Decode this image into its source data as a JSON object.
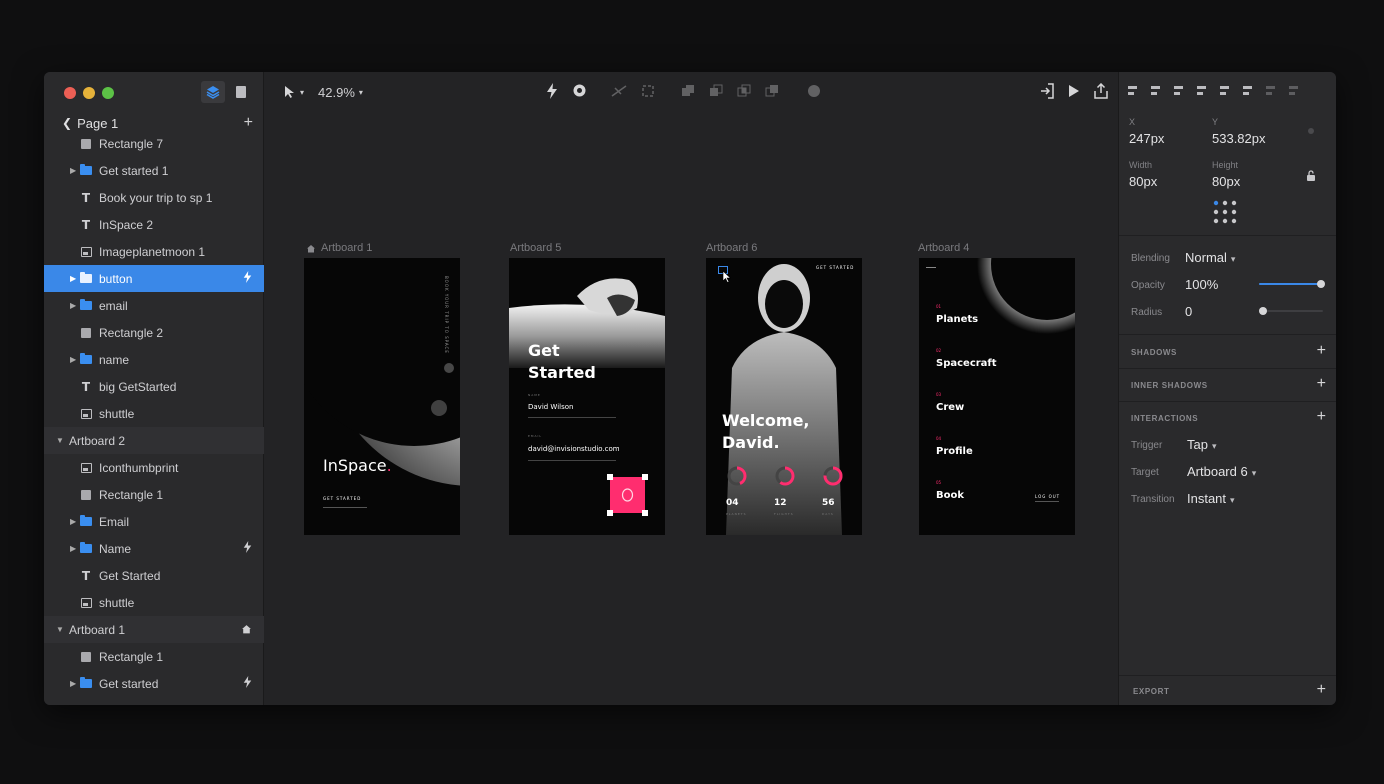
{
  "sidebar": {
    "page_name": "Page 1",
    "layers": [
      {
        "name": "Rectangle 7",
        "kind": "rect",
        "indent": 1,
        "expandable": false,
        "selected": false,
        "section": false,
        "badge": ""
      },
      {
        "name": "Get started 1",
        "kind": "folder",
        "indent": 1,
        "expandable": true,
        "selected": false,
        "section": false,
        "badge": ""
      },
      {
        "name": "Book your trip to sp 1",
        "kind": "text",
        "indent": 1,
        "expandable": false,
        "selected": false,
        "section": false,
        "badge": ""
      },
      {
        "name": "InSpace 2",
        "kind": "text",
        "indent": 1,
        "expandable": false,
        "selected": false,
        "section": false,
        "badge": ""
      },
      {
        "name": "Imageplanetmoon 1",
        "kind": "image",
        "indent": 1,
        "expandable": false,
        "selected": false,
        "section": false,
        "badge": ""
      },
      {
        "name": "button",
        "kind": "folder",
        "indent": 1,
        "expandable": true,
        "selected": true,
        "section": false,
        "badge": "bolt"
      },
      {
        "name": "email",
        "kind": "folder",
        "indent": 1,
        "expandable": true,
        "selected": false,
        "section": false,
        "badge": ""
      },
      {
        "name": "Rectangle 2",
        "kind": "rect",
        "indent": 1,
        "expandable": false,
        "selected": false,
        "section": false,
        "badge": ""
      },
      {
        "name": "name",
        "kind": "folder",
        "indent": 1,
        "expandable": true,
        "selected": false,
        "section": false,
        "badge": ""
      },
      {
        "name": "big GetStarted",
        "kind": "text",
        "indent": 1,
        "expandable": false,
        "selected": false,
        "section": false,
        "badge": ""
      },
      {
        "name": "shuttle",
        "kind": "image",
        "indent": 1,
        "expandable": false,
        "selected": false,
        "section": false,
        "badge": ""
      },
      {
        "name": "Artboard 2",
        "kind": "artboard",
        "indent": 0,
        "expandable": true,
        "selected": false,
        "section": true,
        "badge": ""
      },
      {
        "name": "Iconthumbprint",
        "kind": "image",
        "indent": 1,
        "expandable": false,
        "selected": false,
        "section": false,
        "badge": ""
      },
      {
        "name": "Rectangle 1",
        "kind": "rect",
        "indent": 1,
        "expandable": false,
        "selected": false,
        "section": false,
        "badge": ""
      },
      {
        "name": "Email",
        "kind": "folder",
        "indent": 1,
        "expandable": true,
        "selected": false,
        "section": false,
        "badge": ""
      },
      {
        "name": "Name",
        "kind": "folder",
        "indent": 1,
        "expandable": true,
        "selected": false,
        "section": false,
        "badge": "bolt"
      },
      {
        "name": "Get Started",
        "kind": "text",
        "indent": 1,
        "expandable": false,
        "selected": false,
        "section": false,
        "badge": ""
      },
      {
        "name": "shuttle",
        "kind": "image",
        "indent": 1,
        "expandable": false,
        "selected": false,
        "section": false,
        "badge": ""
      },
      {
        "name": "Artboard 1",
        "kind": "artboard",
        "indent": 0,
        "expandable": true,
        "selected": false,
        "section": true,
        "badge": "home"
      },
      {
        "name": "Rectangle 1",
        "kind": "rect",
        "indent": 1,
        "expandable": false,
        "selected": false,
        "section": false,
        "badge": ""
      },
      {
        "name": "Get started",
        "kind": "folder",
        "indent": 1,
        "expandable": true,
        "selected": false,
        "section": false,
        "badge": "bolt"
      }
    ]
  },
  "toolbar": {
    "zoom": "42.9%"
  },
  "artboards": {
    "a1": {
      "label": "Artboard 1",
      "title": "InSpace",
      "title_dot": ".",
      "cta": "GET STARTED",
      "vertical_text": "BOOK YOUR TRIP TO SPACE"
    },
    "a5": {
      "label": "Artboard 5",
      "title_line1": "Get",
      "title_line2": "Started",
      "name_label": "NAME",
      "name_value": "David Wilson",
      "email_label": "EMAIL",
      "email_value": "david@invisionstudio.com"
    },
    "a6": {
      "label": "Artboard 6",
      "top_right": "GET STARTED",
      "welcome_line1": "Welcome,",
      "welcome_line2": "David.",
      "stats": [
        {
          "value": "04",
          "label": "PLANETS"
        },
        {
          "value": "12",
          "label": "FLIGHTS"
        },
        {
          "value": "56",
          "label": "DAYS"
        }
      ]
    },
    "a4": {
      "label": "Artboard 4",
      "menu": [
        {
          "num": "01",
          "label": "Planets"
        },
        {
          "num": "02",
          "label": "Spacecraft"
        },
        {
          "num": "03",
          "label": "Crew"
        },
        {
          "num": "04",
          "label": "Profile"
        },
        {
          "num": "05",
          "label": "Book"
        }
      ],
      "log_out": "LOG OUT"
    }
  },
  "inspector": {
    "x_label": "X",
    "x_value": "247px",
    "y_label": "Y",
    "y_value": "533.82px",
    "width_label": "Width",
    "width_value": "80px",
    "height_label": "Height",
    "height_value": "80px",
    "blending_label": "Blending",
    "blending_value": "Normal",
    "opacity_label": "Opacity",
    "opacity_value": "100%",
    "opacity_fraction": 1.0,
    "radius_label": "Radius",
    "radius_value": "0",
    "shadows_label": "SHADOWS",
    "inner_shadows_label": "INNER SHADOWS",
    "interactions_label": "INTERACTIONS",
    "trigger_label": "Trigger",
    "trigger_value": "Tap",
    "target_label": "Target",
    "target_value": "Artboard 6",
    "transition_label": "Transition",
    "transition_value": "Instant",
    "export_label": "EXPORT"
  },
  "colors": {
    "selection": "#3a88e8",
    "accent_pink": "#ff2d6f",
    "folder": "#3a8ef0"
  }
}
